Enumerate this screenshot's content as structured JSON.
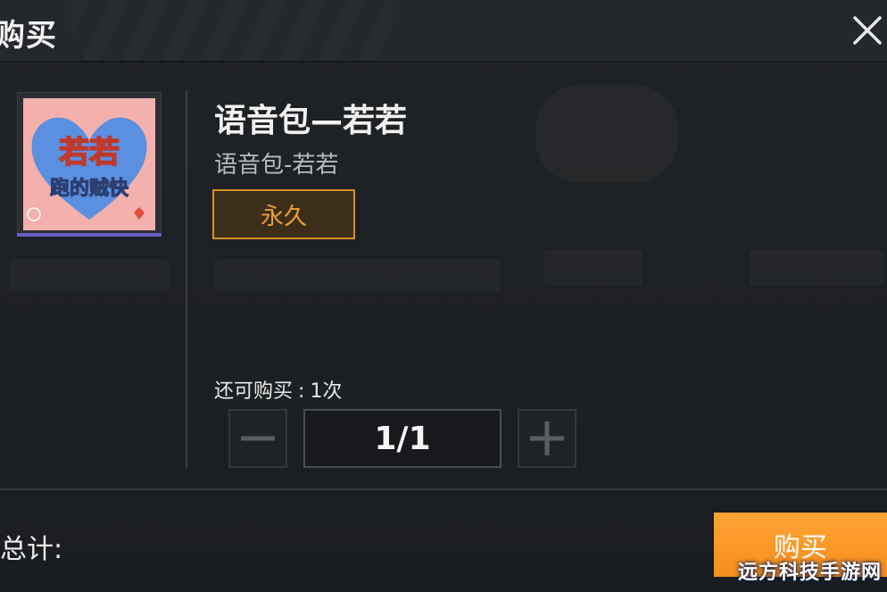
{
  "header": {
    "title": "购买"
  },
  "item": {
    "name": "语音包—若若",
    "subtitle": "语音包-若若",
    "duration": "永久",
    "thumbnail": {
      "top_caption": "若若跑的贼快",
      "line1": "若若",
      "line2": "跑的贼快",
      "bg_color": "#f3b0ad",
      "heart_color": "#5b8fe0"
    }
  },
  "purchase": {
    "remaining_label": "还可购买",
    "remaining_value": "1次",
    "quantity": "1/1"
  },
  "footer": {
    "total_label": "总计:",
    "buy_label": "购买"
  },
  "watermark": "远方科技手游网",
  "colors": {
    "accent_orange": "#f68e1b",
    "tag_border": "#d4902a",
    "panel_bg": "#1d2023"
  }
}
